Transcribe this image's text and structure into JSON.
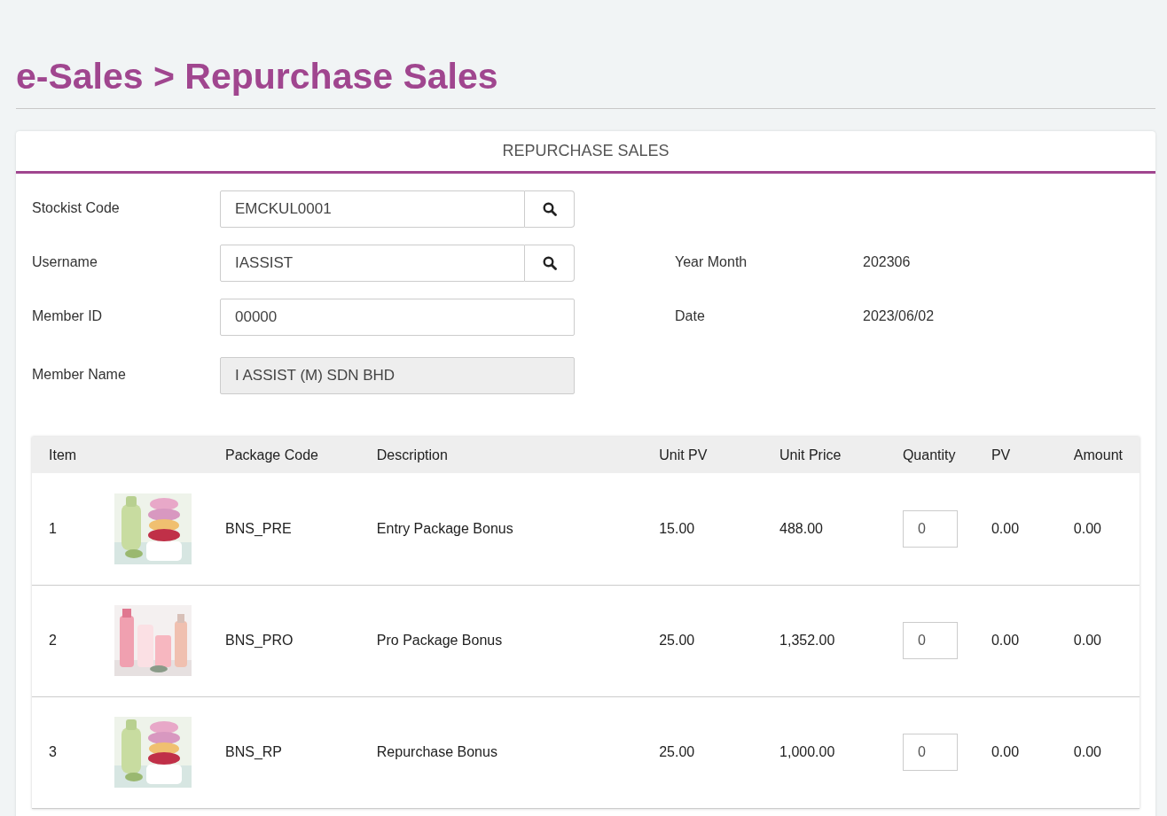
{
  "page_title": "e-Sales > Repurchase Sales",
  "card": {
    "title": "REPURCHASE SALES"
  },
  "form_left": [
    {
      "label": "Stockist Code",
      "value": "EMCKUL0001",
      "search_button": true,
      "disabled": false
    },
    {
      "label": "Username",
      "value": "IASSIST",
      "search_button": true,
      "disabled": false
    },
    {
      "label": "Member ID",
      "value": "00000",
      "search_button": false,
      "disabled": false
    },
    {
      "label": "Member Name",
      "value": "I ASSIST (M) SDN BHD",
      "search_button": false,
      "disabled": true
    }
  ],
  "form_right": [
    {
      "label": "Year Month",
      "value": "202306"
    },
    {
      "label": "Date",
      "value": "2023/06/02"
    }
  ],
  "table": {
    "columns": [
      "Item",
      "",
      "Package Code",
      "Description",
      "Unit PV",
      "Unit Price",
      "Quantity",
      "PV",
      "Amount"
    ],
    "rows": [
      {
        "item": "1",
        "package_code": "BNS_PRE",
        "description": "Entry Package Bonus",
        "unit_pv": "15.00",
        "unit_price": "488.00",
        "quantity": "0",
        "pv": "0.00",
        "amount": "0.00"
      },
      {
        "item": "2",
        "package_code": "BNS_PRO",
        "description": "Pro Package Bonus",
        "unit_pv": "25.00",
        "unit_price": "1,352.00",
        "quantity": "0",
        "pv": "0.00",
        "amount": "0.00"
      },
      {
        "item": "3",
        "package_code": "BNS_RP",
        "description": "Repurchase Bonus",
        "unit_pv": "25.00",
        "unit_price": "1,000.00",
        "quantity": "0",
        "pv": "0.00",
        "amount": "0.00"
      }
    ]
  }
}
